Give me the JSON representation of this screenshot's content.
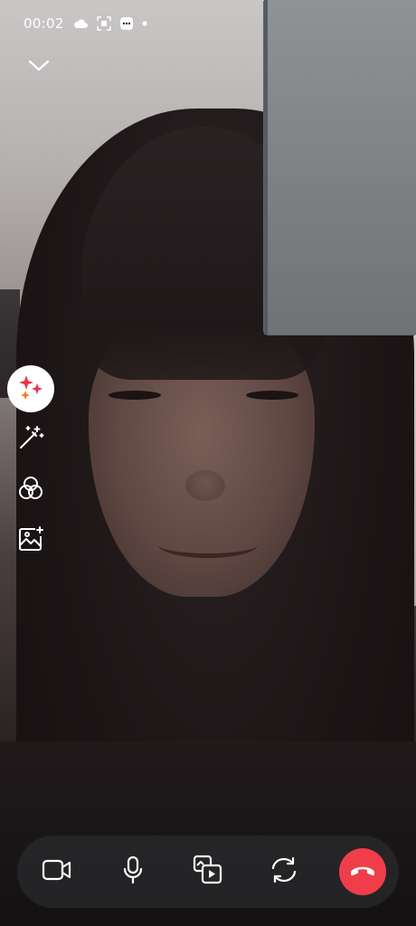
{
  "status_bar": {
    "time": "00:02",
    "icons": [
      "cloud-icon",
      "screenshot-icon",
      "notification-badge-icon",
      "dot-icon"
    ]
  },
  "header": {
    "collapse_icon": "chevron-down-icon"
  },
  "effects_toolbar": {
    "items": [
      {
        "icon": "sparkles-icon",
        "active": true
      },
      {
        "icon": "magic-wand-icon",
        "active": false
      },
      {
        "icon": "filters-icon",
        "active": false
      },
      {
        "icon": "background-image-icon",
        "active": false
      }
    ]
  },
  "controls": {
    "items": [
      {
        "icon": "video-camera-icon"
      },
      {
        "icon": "microphone-icon"
      },
      {
        "icon": "share-screen-icon"
      },
      {
        "icon": "flip-camera-icon"
      },
      {
        "icon": "end-call-icon"
      }
    ]
  },
  "colors": {
    "end_call": "#ef3e4a",
    "control_bar": "#262628",
    "sparkle_red": "#e8334a",
    "sparkle_orange": "#f07a2b"
  }
}
